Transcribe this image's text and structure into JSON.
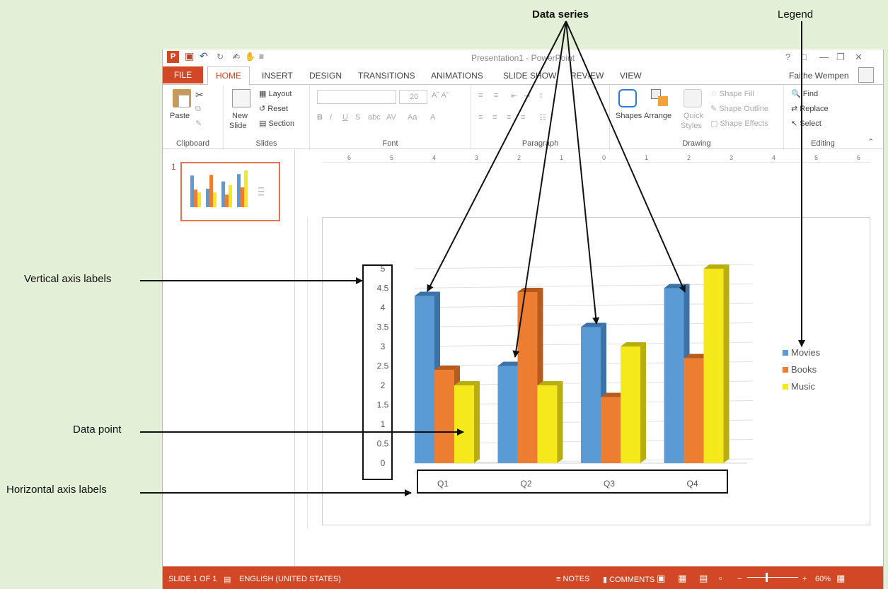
{
  "annotations": {
    "data_series": "Data series",
    "legend": "Legend",
    "vertical_axis_labels": "Vertical axis labels",
    "data_point": "Data point",
    "horizontal_axis_labels": "Horizontal axis labels"
  },
  "window": {
    "title": "Presentation1 - PowerPoint",
    "user": "Faithe Wempen",
    "icons": [
      "save-icon",
      "undo-icon",
      "redo-icon",
      "touch-mode-icon",
      "help-icon",
      "restore-icon",
      "minimize-icon",
      "maximize-icon",
      "close-icon"
    ]
  },
  "tabs": {
    "file": "FILE",
    "home": "HOME",
    "insert": "INSERT",
    "design": "DESIGN",
    "transitions": "TRANSITIONS",
    "animations": "ANIMATIONS",
    "slideshow": "SLIDE SHOW",
    "review": "REVIEW",
    "view": "VIEW"
  },
  "ribbon": {
    "clipboard": {
      "label": "Clipboard",
      "paste": "Paste"
    },
    "slides": {
      "label": "Slides",
      "new_slide": "New",
      "new_slide2": "Slide",
      "layout": "Layout",
      "reset": "Reset",
      "section": "Section"
    },
    "font": {
      "label": "Font",
      "size": "20"
    },
    "paragraph": {
      "label": "Paragraph"
    },
    "drawing": {
      "label": "Drawing",
      "shapes": "Shapes",
      "arrange": "Arrange",
      "quick_styles": "Quick",
      "quick_styles2": "Styles",
      "shape_fill": "Shape Fill",
      "shape_outline": "Shape Outline",
      "shape_effects": "Shape Effects"
    },
    "editing": {
      "label": "Editing",
      "find": "Find",
      "replace": "Replace",
      "select": "Select"
    }
  },
  "thumbnail": {
    "number": "1"
  },
  "status": {
    "slide": "SLIDE 1 OF 1",
    "language": "ENGLISH (UNITED STATES)",
    "notes": "NOTES",
    "comments": "COMMENTS",
    "zoom": "60%"
  },
  "colors": {
    "movies": "#5b9bd5",
    "books": "#ed7d31",
    "music": "#f5e81b",
    "accent": "#d24726"
  },
  "chart_data": {
    "type": "bar",
    "categories": [
      "Q1",
      "Q2",
      "Q3",
      "Q4"
    ],
    "series": [
      {
        "name": "Movies",
        "values": [
          4.3,
          2.5,
          3.5,
          4.5
        ]
      },
      {
        "name": "Books",
        "values": [
          2.4,
          4.4,
          1.7,
          2.7
        ]
      },
      {
        "name": "Music",
        "values": [
          2.0,
          2.0,
          3.0,
          5.0
        ]
      }
    ],
    "yticks": [
      "0",
      "0.5",
      "1",
      "1.5",
      "2",
      "2.5",
      "3",
      "3.5",
      "4",
      "4.5",
      "5"
    ],
    "ylim": [
      0,
      5
    ],
    "grid": true,
    "legend": "right"
  }
}
